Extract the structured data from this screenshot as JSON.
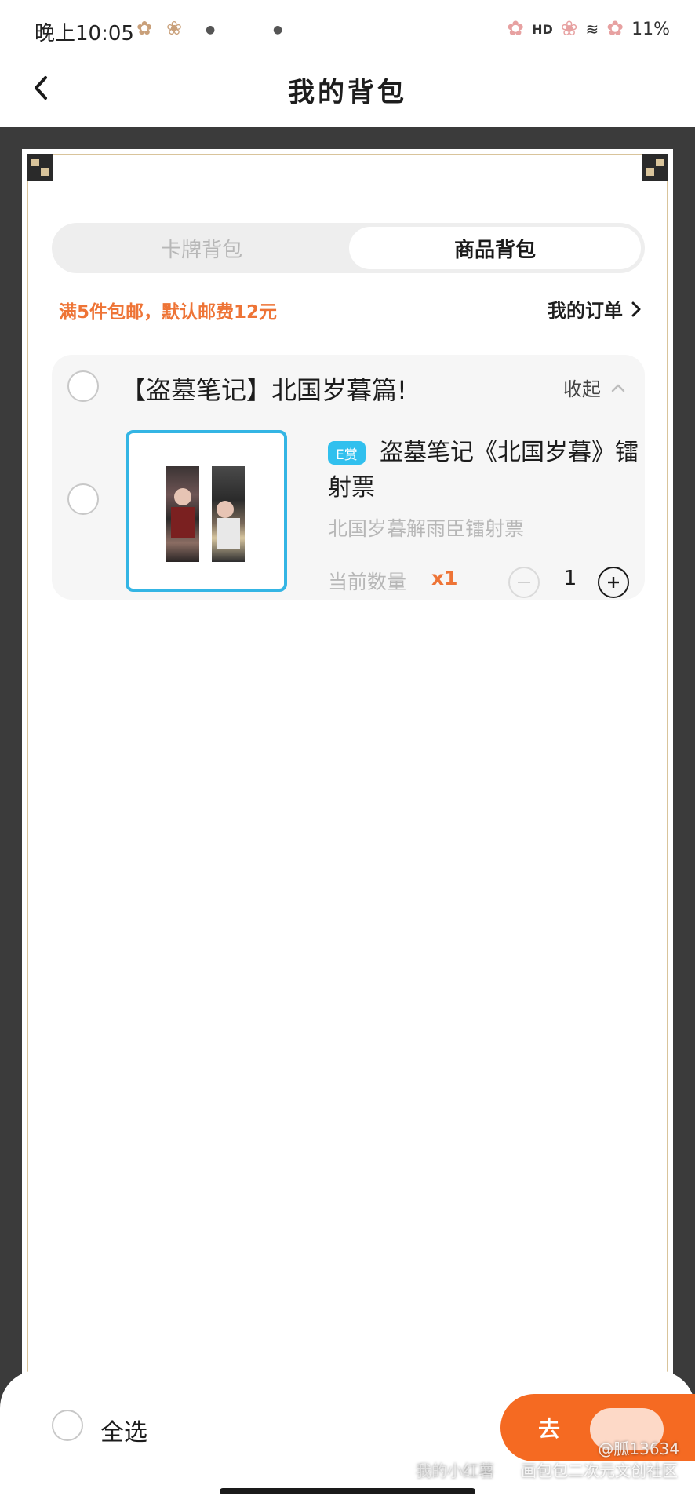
{
  "status_bar": {
    "time": "晚上10:05",
    "network": "HD",
    "battery": "11%"
  },
  "header": {
    "title": "我的背包"
  },
  "tabs": [
    {
      "label": "卡牌背包",
      "active": false
    },
    {
      "label": "商品背包",
      "active": true
    }
  ],
  "shipping_note": "满5件包邮，默认邮费12元",
  "my_orders_label": "我的订单",
  "group": {
    "title": "【盗墓笔记】北国岁暮篇!",
    "collapse_label": "收起",
    "item": {
      "badge": "E赏",
      "name": "盗墓笔记《北国岁暮》镭射票",
      "description": "北国岁暮解雨臣镭射票",
      "quantity_label": "当前数量",
      "quantity_value": "x1",
      "count": "1"
    }
  },
  "bottom_bar": {
    "select_all_label": "全选",
    "checkout_label": "去"
  },
  "watermarks": {
    "user": "@胍13634",
    "community": "画包包二次元文创社区",
    "faint": "我的小红薯"
  },
  "colors": {
    "accent_orange": "#f56a22",
    "note_orange": "#ee7436",
    "badge_blue": "#31c0ee",
    "frame_gold": "#d9c49b"
  }
}
